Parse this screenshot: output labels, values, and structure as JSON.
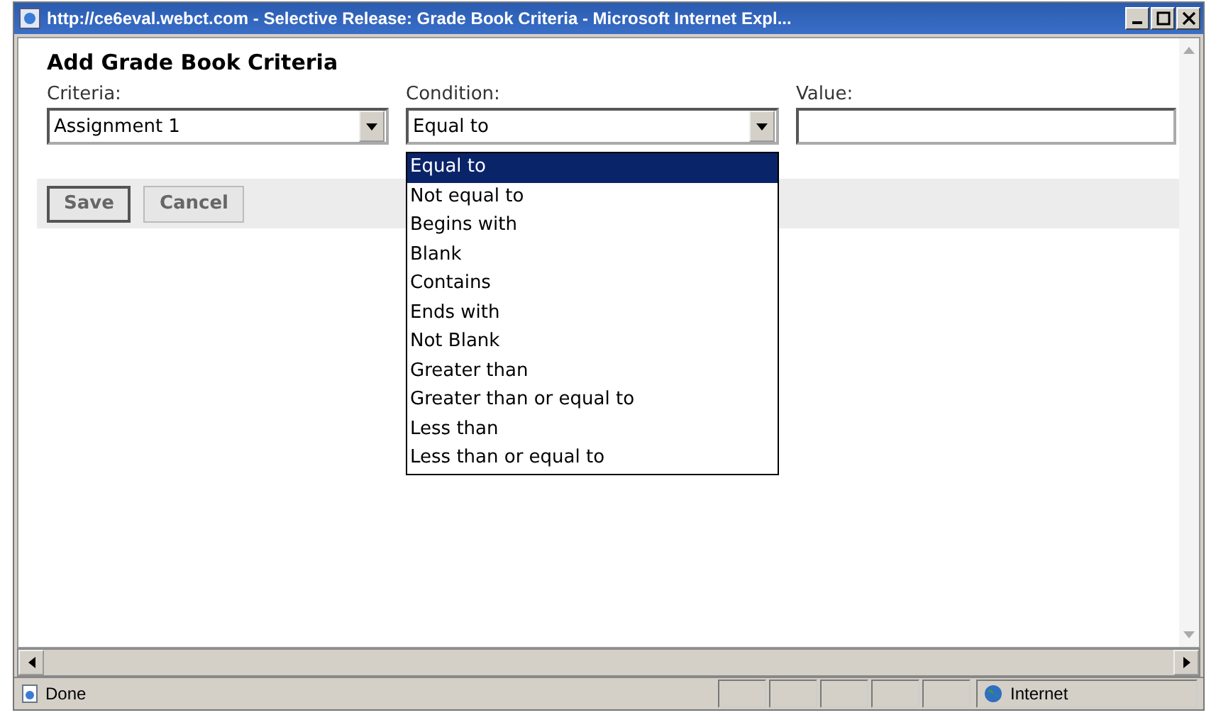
{
  "window": {
    "title": "http://ce6eval.webct.com - Selective Release: Grade Book Criteria - Microsoft Internet Expl..."
  },
  "heading": "Add Grade Book Criteria",
  "fields": [
    {
      "kind": "select",
      "label": "Criteria:",
      "value": "Assignment 1"
    },
    {
      "kind": "select",
      "label": "Condition:",
      "value": "Equal to",
      "expanded": true
    },
    {
      "kind": "text",
      "label": "Value:"
    }
  ],
  "dropdown_options": [
    {
      "label": "Equal to",
      "selected": true
    },
    {
      "label": "Not equal to",
      "selected": false
    },
    {
      "label": "Begins with",
      "selected": false
    },
    {
      "label": "Blank",
      "selected": false
    },
    {
      "label": "Contains",
      "selected": false
    },
    {
      "label": "Ends with",
      "selected": false
    },
    {
      "label": "Not Blank",
      "selected": false
    },
    {
      "label": "Greater than",
      "selected": false
    },
    {
      "label": "Greater than or equal to",
      "selected": false
    },
    {
      "label": "Less than",
      "selected": false
    },
    {
      "label": "Less than or equal to",
      "selected": false
    }
  ],
  "buttons": [
    {
      "label": "Save",
      "default": true
    },
    {
      "label": "Cancel",
      "default": false
    }
  ],
  "status_bar": {
    "text": "Done",
    "zone": "Internet"
  }
}
